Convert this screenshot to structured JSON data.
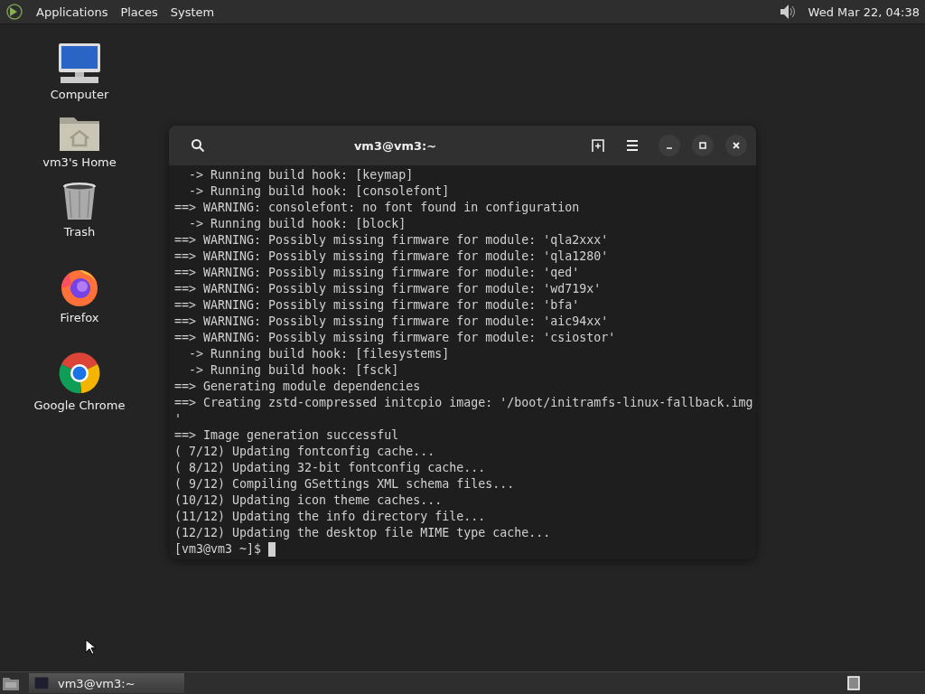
{
  "top_panel": {
    "menus": [
      "Applications",
      "Places",
      "System"
    ],
    "clock": "Wed Mar 22, 04:38"
  },
  "desktop_icons": [
    {
      "kind": "computer",
      "label": "Computer"
    },
    {
      "kind": "home",
      "label": "vm3's Home"
    },
    {
      "kind": "trash",
      "label": "Trash"
    },
    {
      "kind": "firefox",
      "label": "Firefox"
    },
    {
      "kind": "chrome",
      "label": "Google Chrome"
    }
  ],
  "terminal": {
    "title": "vm3@vm3:~",
    "lines": [
      "  -> Running build hook: [keymap]",
      "  -> Running build hook: [consolefont]",
      "==> WARNING: consolefont: no font found in configuration",
      "  -> Running build hook: [block]",
      "==> WARNING: Possibly missing firmware for module: 'qla2xxx'",
      "==> WARNING: Possibly missing firmware for module: 'qla1280'",
      "==> WARNING: Possibly missing firmware for module: 'qed'",
      "==> WARNING: Possibly missing firmware for module: 'wd719x'",
      "==> WARNING: Possibly missing firmware for module: 'bfa'",
      "==> WARNING: Possibly missing firmware for module: 'aic94xx'",
      "==> WARNING: Possibly missing firmware for module: 'csiostor'",
      "  -> Running build hook: [filesystems]",
      "  -> Running build hook: [fsck]",
      "==> Generating module dependencies",
      "==> Creating zstd-compressed initcpio image: '/boot/initramfs-linux-fallback.img",
      "'",
      "==> Image generation successful",
      "( 7/12) Updating fontconfig cache...",
      "( 8/12) Updating 32-bit fontconfig cache...",
      "( 9/12) Compiling GSettings XML schema files...",
      "(10/12) Updating icon theme caches...",
      "(11/12) Updating the info directory file...",
      "(12/12) Updating the desktop file MIME type cache...",
      "[vm3@vm3 ~]$"
    ]
  },
  "taskbar": {
    "tasks": [
      {
        "label": "vm3@vm3:~",
        "selected": true
      }
    ]
  }
}
